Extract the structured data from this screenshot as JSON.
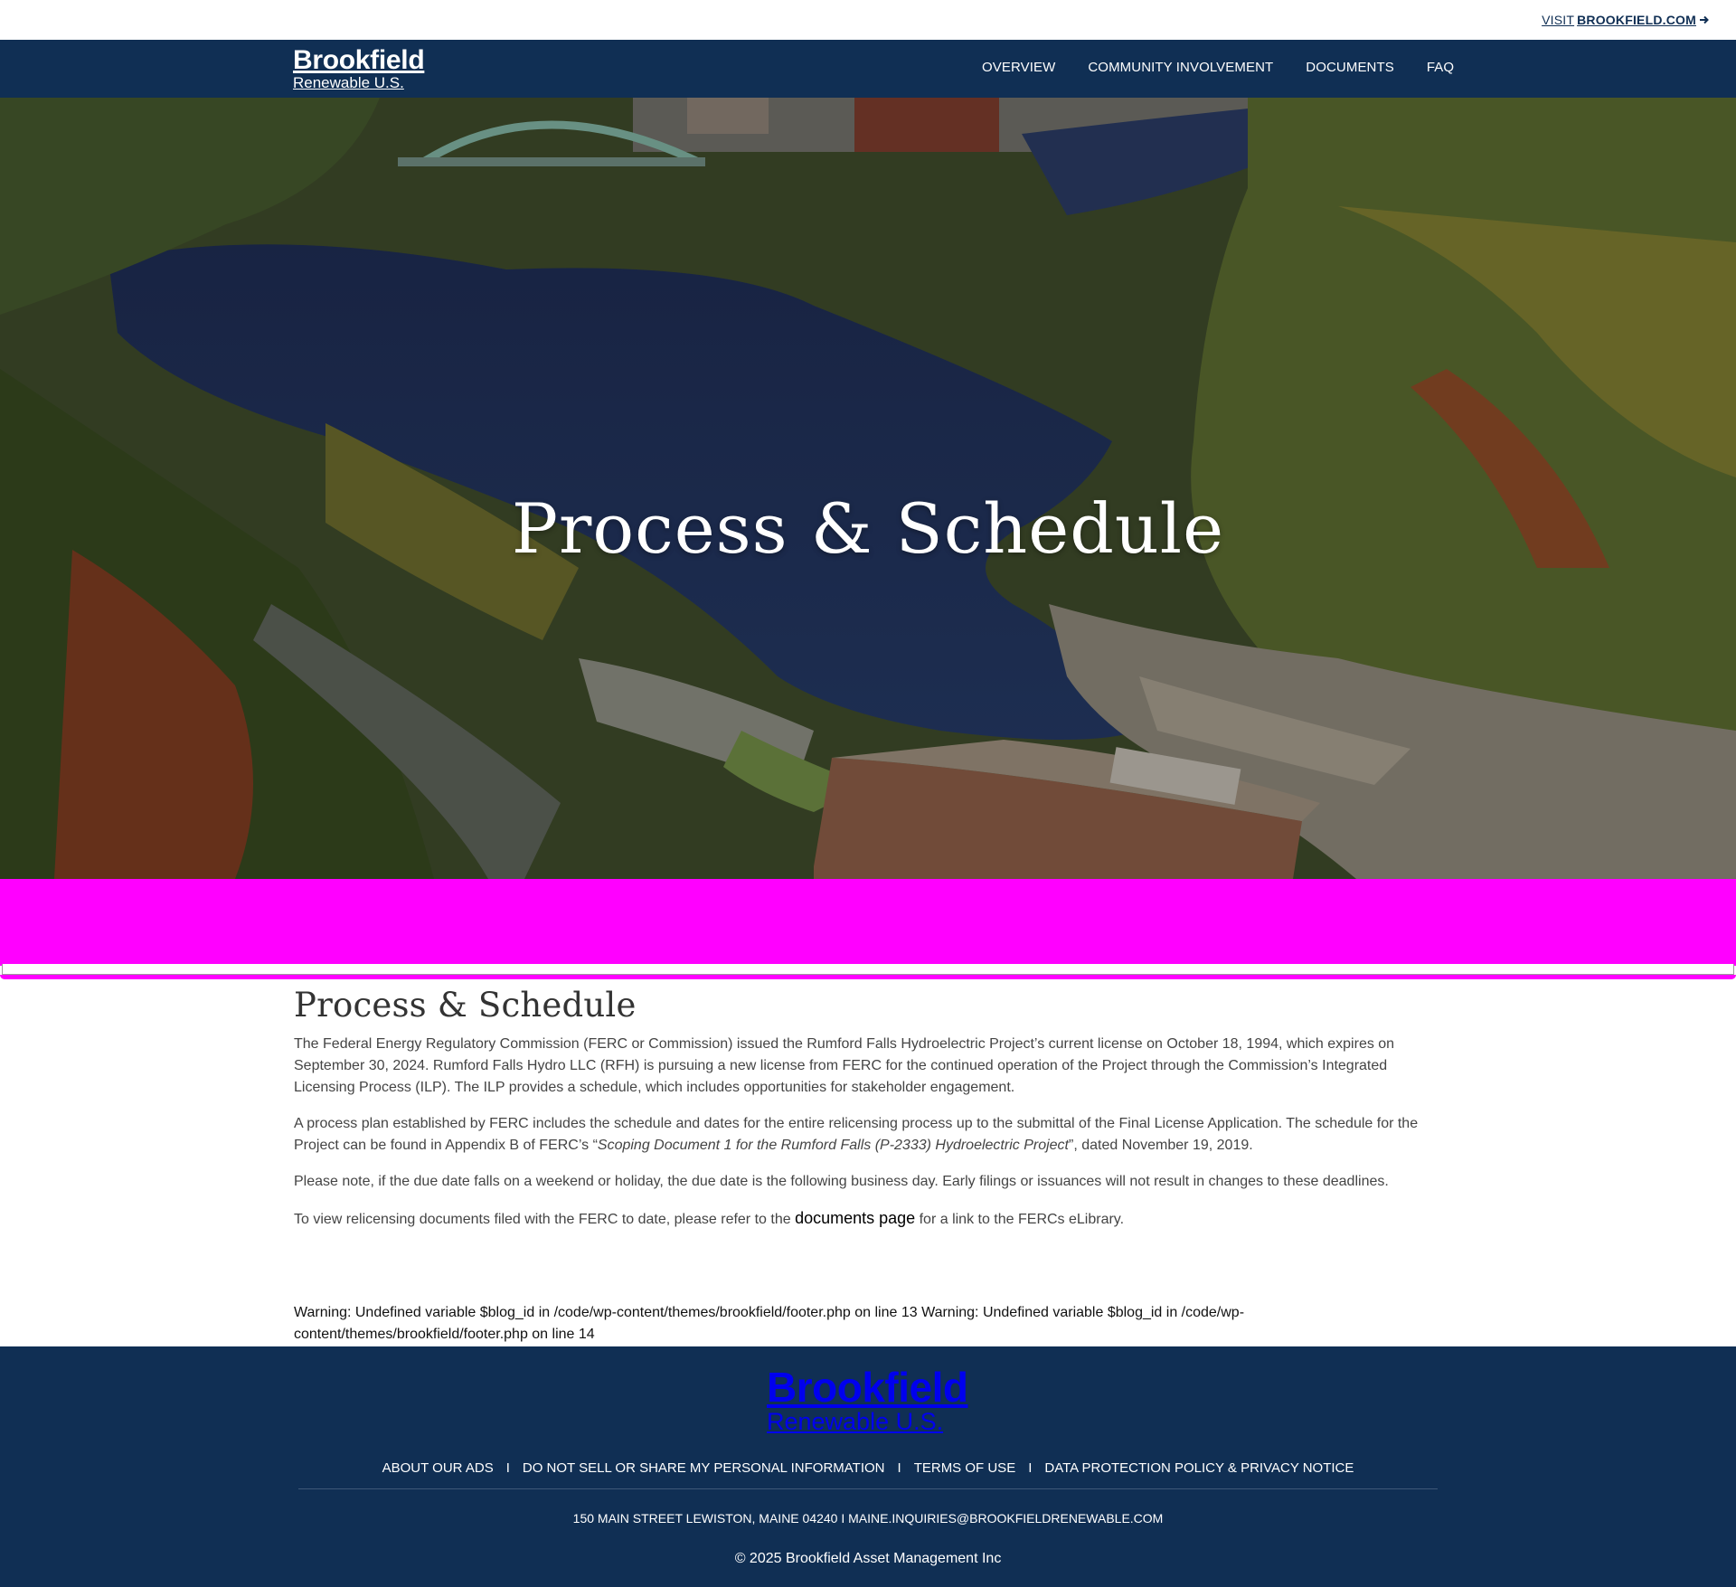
{
  "topbar": {
    "visit_prefix": "VISIT ",
    "visit_domain": "BROOKFIELD.COM"
  },
  "brand": {
    "name": "Brookfield",
    "sub": "Renewable U.S."
  },
  "nav": {
    "items": [
      {
        "label": "OVERVIEW"
      },
      {
        "label": "COMMUNITY INVOLVEMENT"
      },
      {
        "label": "DOCUMENTS"
      },
      {
        "label": "FAQ"
      }
    ]
  },
  "hero": {
    "title": "Process & Schedule"
  },
  "main": {
    "heading": "Process & Schedule",
    "p1": "The Federal Energy Regulatory Commission (FERC or Commission) issued the Rumford Falls Hydroelectric Project’s current license on October 18, 1994, which expires on September 30, 2024.  Rumford Falls Hydro LLC (RFH) is pursuing a new license from FERC for the continued operation of the Project through the Commission’s Integrated Licensing Process (ILP). The ILP provides a schedule, which includes opportunities for stakeholder engagement.",
    "p2_a": "A process plan established by FERC includes the schedule and dates for the entire relicensing process up to the submittal of the Final License Application. The schedule for the Project can be found in Appendix B of FERC’s “",
    "p2_italic": "Scoping Document 1 for the Rumford Falls (P-2333) Hydroelectric Project",
    "p2_b": "”, dated November 19, 2019.",
    "p3": "Please note, if the due date falls on a weekend or holiday, the due date is the following business day. Early filings or issuances will not result in changes to these deadlines.",
    "p4_a": "To view relicensing documents filed with the FERC to date, please refer to the ",
    "p4_link": "documents page",
    "p4_b": " for a link to the FERCs eLibrary."
  },
  "warning": {
    "text": "Warning: Undefined variable $blog_id in /code/wp-content/themes/brookfield/footer.php on line 13 Warning: Undefined variable $blog_id in /code/wp-content/themes/brookfield/footer.php on line 14"
  },
  "footer": {
    "links": [
      {
        "label": "ABOUT OUR ADS"
      },
      {
        "label": "DO NOT SELL OR SHARE MY PERSONAL INFORMATION"
      },
      {
        "label": "TERMS OF USE"
      },
      {
        "label": "DATA PROTECTION POLICY & PRIVACY NOTICE"
      }
    ],
    "separator": "I",
    "address": "150 MAIN STREET LEWISTON, MAINE 04240",
    "address_sep": " I ",
    "email": "MAINE.INQUIRIES@BROOKFIELDRENEWABLE.COM",
    "copyright": "© 2025 Brookfield Asset Management Inc"
  },
  "colors": {
    "navy": "#102f54",
    "ad_placeholder": "#ff00ff"
  },
  "icons": {
    "visit_arrow": "arrow-right-icon"
  }
}
